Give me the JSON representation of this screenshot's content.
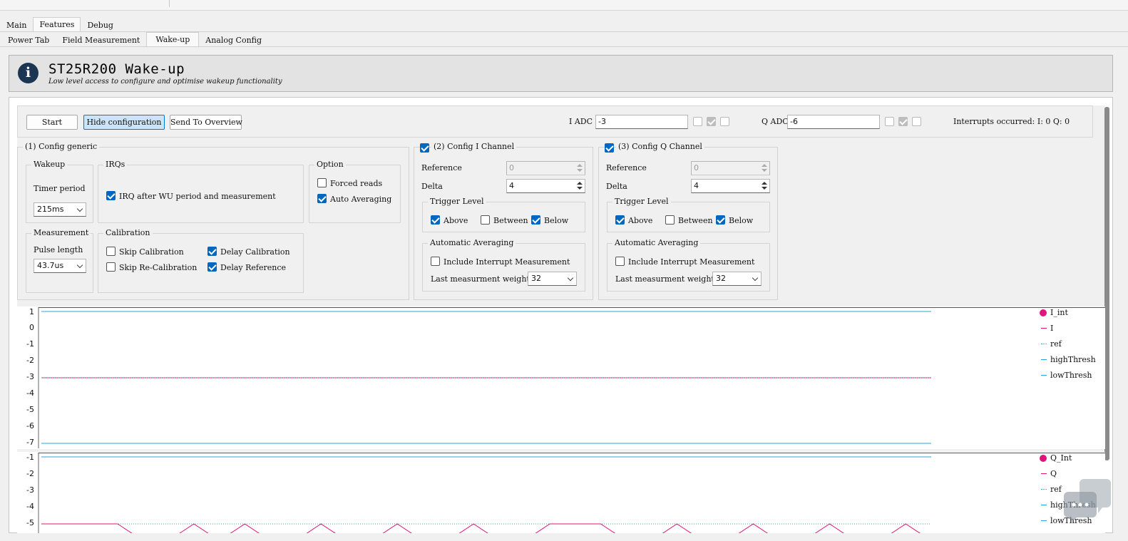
{
  "tabs_main": [
    "Main",
    "Features",
    "Debug"
  ],
  "tabs_sub": [
    "Power Tab",
    "Field Measurement",
    "Wake-up",
    "Analog Config"
  ],
  "banner": {
    "icon": "info-icon",
    "title": "ST25R200 Wake-up",
    "subtitle": "Low level access to configure and optimise wakeup functionality"
  },
  "toolbar": {
    "start": "Start",
    "hide_config": "Hide configuration",
    "send_overview": "Send To Overview",
    "i_adc_label": "I ADC",
    "i_adc_value": "-3",
    "q_adc_label": "Q ADC",
    "q_adc_value": "-6",
    "interrupts": "Interrupts occurred: I: 0 Q: 0"
  },
  "generic": {
    "title": "(1) Config generic",
    "wakeup_title": "Wakeup",
    "timer_label": "Timer period",
    "timer_value": "215ms",
    "irqs_title": "IRQs",
    "irq_label": "IRQ after WU period and measurement",
    "irq_checked": true,
    "option_title": "Option",
    "forced_reads": "Forced reads",
    "forced_reads_checked": false,
    "auto_avg": "Auto Averaging",
    "auto_avg_checked": true,
    "measurement_title": "Measurement",
    "pulse_label": "Pulse length",
    "pulse_value": "43.7us",
    "calibration_title": "Calibration",
    "skip_cal": "Skip Calibration",
    "skip_recal": "Skip Re-Calibration",
    "delay_cal": "Delay Calibration",
    "delay_ref": "Delay Reference"
  },
  "channel_i": {
    "title": "(2) Config I Channel",
    "reference_label": "Reference",
    "reference_value": "0",
    "delta_label": "Delta",
    "delta_value": "4",
    "trigger_title": "Trigger Level",
    "above": "Above",
    "between": "Between",
    "below": "Below",
    "avg_title": "Automatic Averaging",
    "include": "Include Interrupt Measurement",
    "weight_label": "Last measurment weight",
    "weight_value": "32"
  },
  "channel_q": {
    "title": "(3) Config Q Channel",
    "reference_label": "Reference",
    "reference_value": "0",
    "delta_label": "Delta",
    "delta_value": "4",
    "trigger_title": "Trigger Level",
    "above": "Above",
    "between": "Between",
    "below": "Below",
    "avg_title": "Automatic Averaging",
    "include": "Include Interrupt Measurement",
    "weight_label": "Last measurment weight",
    "weight_value": "32"
  },
  "colors": {
    "accent": "#0067c0",
    "int_series": "#e0147a",
    "threshold_line": "#2aa7d8",
    "ref_dotted": "#2bb3a3",
    "banner_icon": "#1c3553"
  },
  "chart_data": [
    {
      "type": "line",
      "ylim": [
        -7,
        1
      ],
      "yticks": [
        "1",
        "0",
        "-1",
        "-2",
        "-3",
        "-4",
        "-5",
        "-6",
        "-7"
      ],
      "legend": [
        "I_int",
        "I",
        "ref",
        "highThresh",
        "lowThresh"
      ],
      "series": [
        {
          "name": "I",
          "values": [
            -3,
            -3
          ]
        },
        {
          "name": "highThresh",
          "values": [
            1,
            1
          ]
        },
        {
          "name": "lowThresh",
          "values": [
            -7,
            -7
          ]
        }
      ]
    },
    {
      "type": "line",
      "ylim": [
        -5,
        -1
      ],
      "yticks": [
        "-1",
        "-2",
        "-3",
        "-4",
        "-5"
      ],
      "legend": [
        "Q_Int",
        "Q",
        "ref",
        "highThresh",
        "lowThresh"
      ],
      "series": [
        {
          "name": "Q",
          "values": [
            -5,
            -5,
            -5,
            -5,
            -6,
            -6,
            -5,
            -6,
            -5,
            -6,
            -6,
            -5,
            -6,
            -6,
            -5,
            -6,
            -6,
            -5,
            -6,
            -6,
            -5,
            -5,
            -5,
            -6,
            -6,
            -5,
            -6,
            -6,
            -5,
            -6,
            -6,
            -5,
            -6,
            -6,
            -5,
            -6
          ]
        },
        {
          "name": "ref",
          "values": [
            -5,
            -5
          ]
        },
        {
          "name": "highThresh",
          "values": [
            -1,
            -1
          ]
        }
      ]
    }
  ]
}
